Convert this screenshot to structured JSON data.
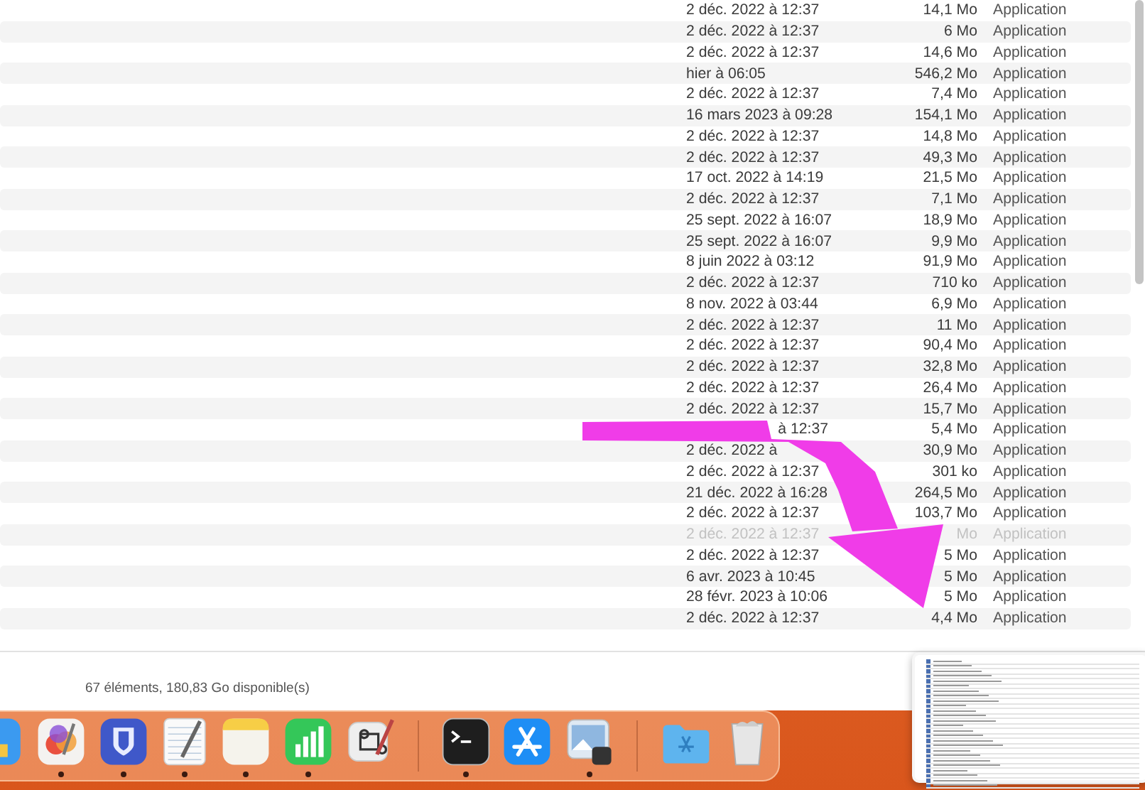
{
  "file_list": {
    "rows": [
      {
        "date": "2 déc. 2022 à 12:37",
        "size": "14,1 Mo",
        "kind": "Application",
        "dimmed": false
      },
      {
        "date": "2 déc. 2022 à 12:37",
        "size": "6 Mo",
        "kind": "Application",
        "dimmed": false
      },
      {
        "date": "2 déc. 2022 à 12:37",
        "size": "14,6 Mo",
        "kind": "Application",
        "dimmed": false
      },
      {
        "date": "hier à 06:05",
        "size": "546,2 Mo",
        "kind": "Application",
        "dimmed": false
      },
      {
        "date": "2 déc. 2022 à 12:37",
        "size": "7,4 Mo",
        "kind": "Application",
        "dimmed": false
      },
      {
        "date": "16 mars 2023 à 09:28",
        "size": "154,1 Mo",
        "kind": "Application",
        "dimmed": false
      },
      {
        "date": "2 déc. 2022 à 12:37",
        "size": "14,8 Mo",
        "kind": "Application",
        "dimmed": false
      },
      {
        "date": "2 déc. 2022 à 12:37",
        "size": "49,3 Mo",
        "kind": "Application",
        "dimmed": false
      },
      {
        "date": "17 oct. 2022 à 14:19",
        "size": "21,5 Mo",
        "kind": "Application",
        "dimmed": false
      },
      {
        "date": "2 déc. 2022 à 12:37",
        "size": "7,1 Mo",
        "kind": "Application",
        "dimmed": false
      },
      {
        "date": "25 sept. 2022 à 16:07",
        "size": "18,9 Mo",
        "kind": "Application",
        "dimmed": false
      },
      {
        "date": "25 sept. 2022 à 16:07",
        "size": "9,9 Mo",
        "kind": "Application",
        "dimmed": false
      },
      {
        "date": "8 juin 2022 à 03:12",
        "size": "91,9 Mo",
        "kind": "Application",
        "dimmed": false
      },
      {
        "date": "2 déc. 2022 à 12:37",
        "size": "710 ko",
        "kind": "Application",
        "dimmed": false
      },
      {
        "date": "8 nov. 2022 à 03:44",
        "size": "6,9 Mo",
        "kind": "Application",
        "dimmed": false
      },
      {
        "date": "2 déc. 2022 à 12:37",
        "size": "11 Mo",
        "kind": "Application",
        "dimmed": false
      },
      {
        "date": "2 déc. 2022 à 12:37",
        "size": "90,4 Mo",
        "kind": "Application",
        "dimmed": false
      },
      {
        "date": "2 déc. 2022 à 12:37",
        "size": "32,8 Mo",
        "kind": "Application",
        "dimmed": false
      },
      {
        "date": "2 déc. 2022 à 12:37",
        "size": "26,4 Mo",
        "kind": "Application",
        "dimmed": false
      },
      {
        "date": "2 déc. 2022 à 12:37",
        "size": "15,7 Mo",
        "kind": "Application",
        "dimmed": false
      },
      {
        "date": "à 12:37",
        "size": "5,4 Mo",
        "kind": "Application",
        "dimmed": false,
        "hidden_start": true
      },
      {
        "date": "2 déc. 2022 à",
        "size": "30,9 Mo",
        "kind": "Application",
        "dimmed": false
      },
      {
        "date": "2 déc. 2022 à 12:37",
        "size": "301 ko",
        "kind": "Application",
        "dimmed": false
      },
      {
        "date": "21 déc. 2022 à 16:28",
        "size": "264,5 Mo",
        "kind": "Application",
        "dimmed": false
      },
      {
        "date": "2 déc. 2022 à 12:37",
        "size": "103,7 Mo",
        "kind": "Application",
        "dimmed": false
      },
      {
        "date": "2 déc. 2022 à 12:37",
        "size": "Mo",
        "kind": "Application",
        "dimmed": true
      },
      {
        "date": "2 déc. 2022 à 12:37",
        "size": "5 Mo",
        "kind": "Application",
        "dimmed": false
      },
      {
        "date": "6 avr. 2023 à 10:45",
        "size": "5 Mo",
        "kind": "Application",
        "dimmed": false
      },
      {
        "date": "28 févr. 2023 à 10:06",
        "size": "5 Mo",
        "kind": "Application",
        "dimmed": false
      },
      {
        "date": "2 déc. 2022 à 12:37",
        "size": "4,4 Mo",
        "kind": "Application",
        "dimmed": false
      }
    ]
  },
  "status_bar": "67 éléments, 180,83 Go disponible(s)",
  "dock": {
    "items": [
      {
        "kind": "partial",
        "running": false
      },
      {
        "kind": "pinwheel",
        "running": true
      },
      {
        "kind": "lock",
        "running": true
      },
      {
        "kind": "notepad",
        "running": true
      },
      {
        "kind": "notes",
        "running": true
      },
      {
        "kind": "chart",
        "running": true
      },
      {
        "kind": "command",
        "running": false
      },
      {
        "kind": "separator"
      },
      {
        "kind": "terminal",
        "running": true
      },
      {
        "kind": "store",
        "running": false
      },
      {
        "kind": "preview",
        "running": true
      },
      {
        "kind": "separator"
      },
      {
        "kind": "folder",
        "running": false
      },
      {
        "kind": "trash",
        "running": false
      }
    ]
  }
}
